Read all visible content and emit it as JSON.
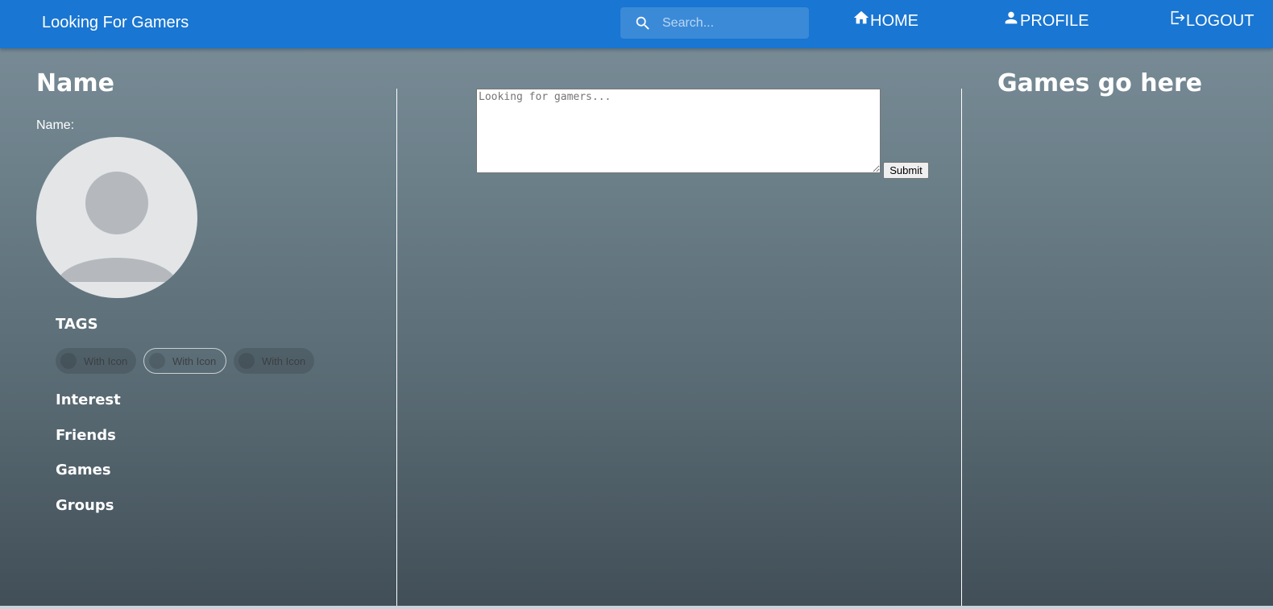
{
  "appbar": {
    "brand": "Looking For Gamers",
    "search": {
      "placeholder": "Search...",
      "icon": "search-icon"
    },
    "nav": [
      {
        "label": "HOME",
        "icon": "home-icon"
      },
      {
        "label": "PROFILE",
        "icon": "person-icon"
      },
      {
        "label": "LOGOUT",
        "icon": "logout-icon"
      }
    ],
    "color": "#1976d2"
  },
  "profile": {
    "heading": "Name",
    "name_label": "Name:",
    "avatar_icon": "default-avatar-icon",
    "tags_title": "TAGS",
    "tags": [
      {
        "label": "With Icon",
        "variant": "filled"
      },
      {
        "label": "With Icon",
        "variant": "outlined"
      },
      {
        "label": "With Icon",
        "variant": "filled"
      }
    ],
    "sections": [
      "Interest",
      "Friends",
      "Games",
      "Groups"
    ]
  },
  "feed": {
    "post_placeholder": "Looking for gamers...",
    "submit_label": "Submit"
  },
  "games": {
    "heading": "Games go here"
  }
}
